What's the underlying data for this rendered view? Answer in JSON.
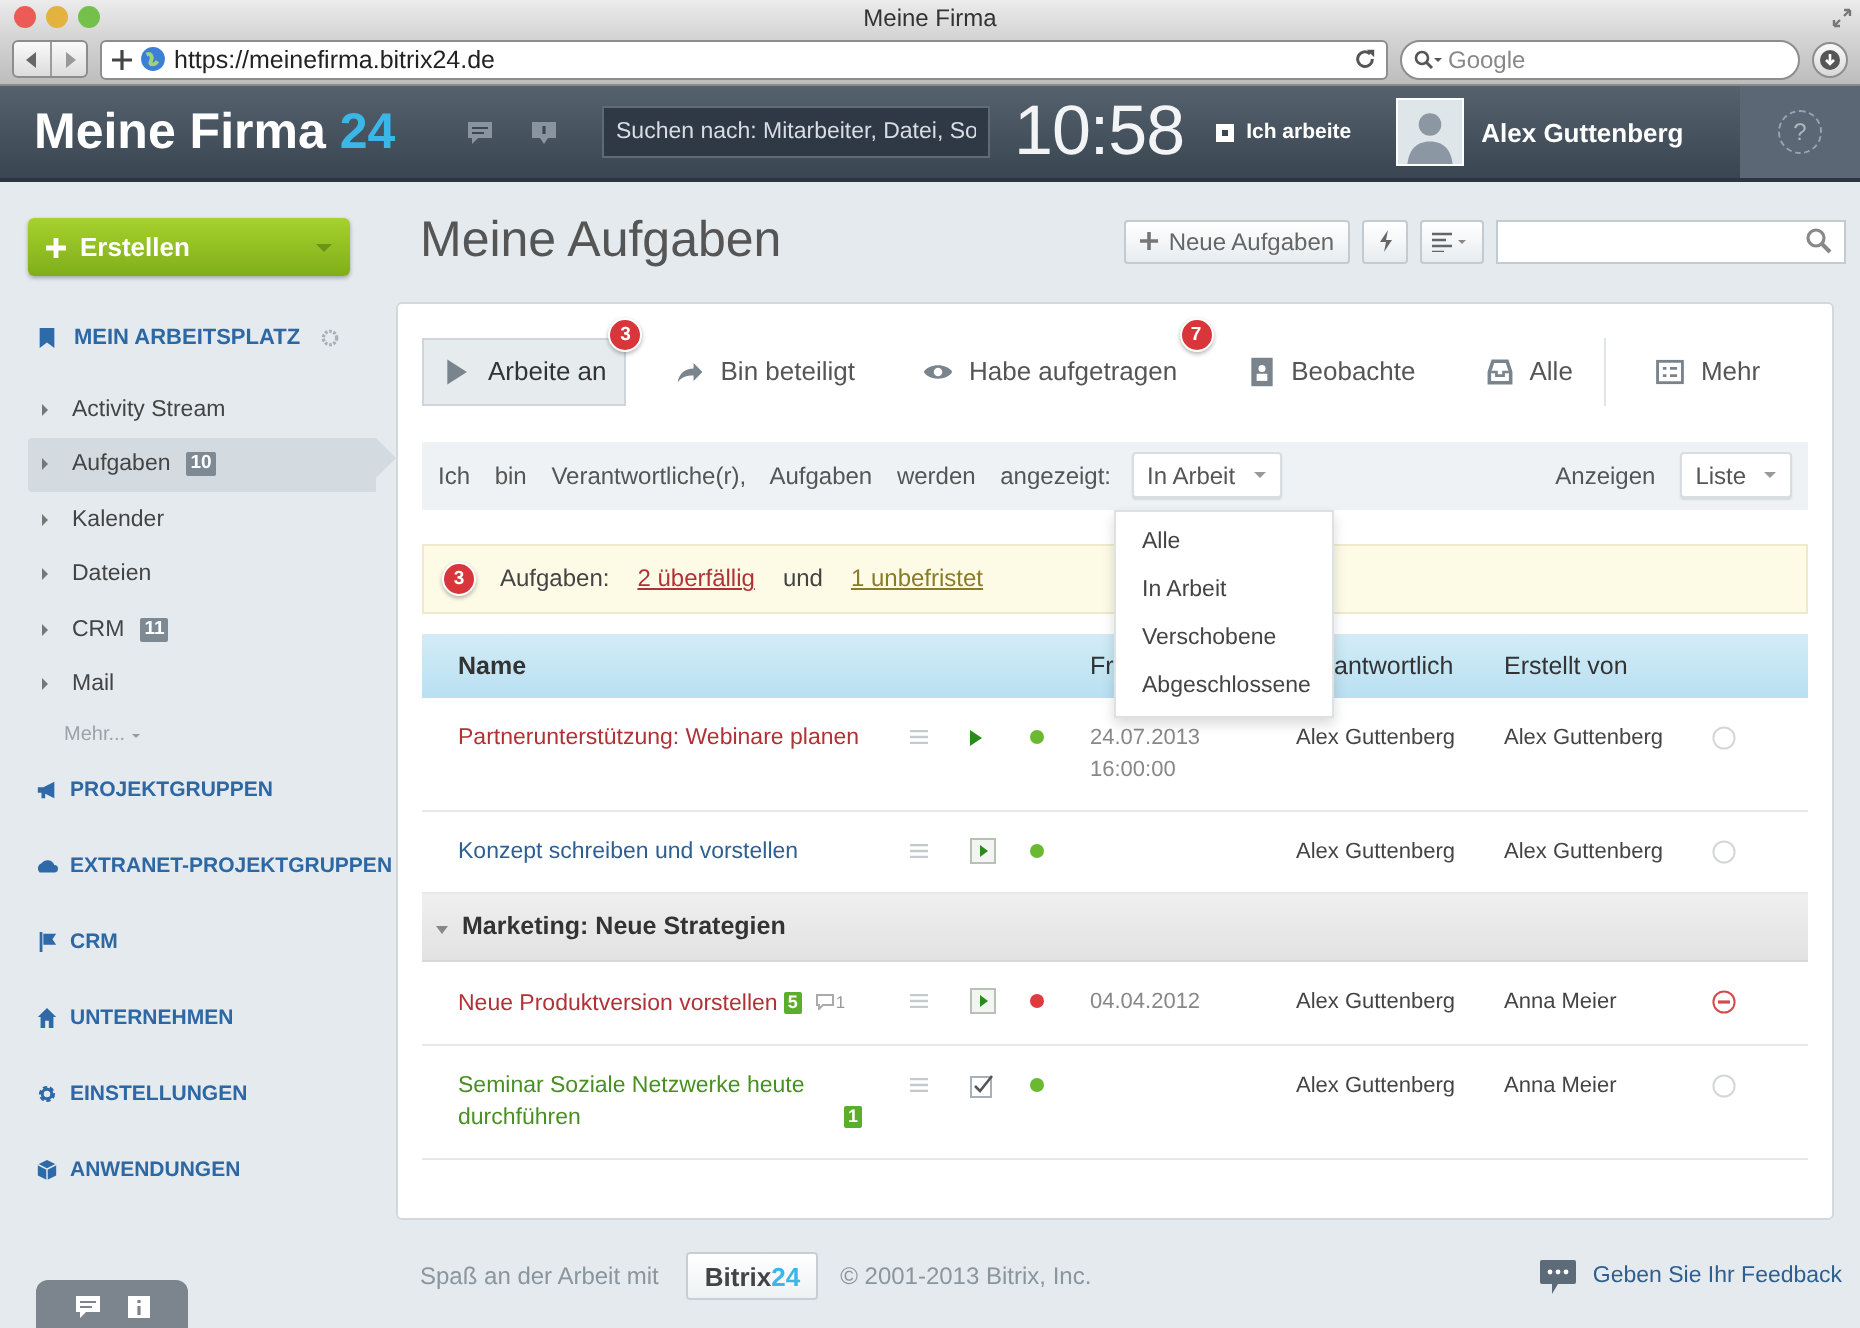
{
  "window": {
    "title": "Meine Firma"
  },
  "browser": {
    "url": "https://meinefirma.bitrix24.de",
    "search_placeholder": "Google"
  },
  "header": {
    "logo": "Meine Firma",
    "logo_number": "24",
    "search_placeholder": "Suchen nach: Mitarbeiter, Datei, So",
    "clock": "10:58",
    "work_label": "Ich arbeite",
    "working": true,
    "user": "Alex Guttenberg",
    "help": "?"
  },
  "create_button": "Erstellen",
  "sidebar": {
    "workspace": "MEIN ARBEITSPLATZ",
    "items": [
      {
        "label": "Activity Stream",
        "selected": false
      },
      {
        "label": "Aufgaben",
        "counter": "10",
        "selected": true
      },
      {
        "label": "Kalender",
        "selected": false
      },
      {
        "label": "Dateien",
        "selected": false
      },
      {
        "label": "CRM",
        "counter": "11",
        "selected": false
      },
      {
        "label": "Mail",
        "selected": false
      }
    ],
    "more": "Mehr...",
    "sections": [
      "PROJEKTGRUPPEN",
      "EXTRANET-PROJEKTGRUPPEN",
      "CRM",
      "UNTERNEHMEN",
      "EINSTELLUNGEN",
      "ANWENDUNGEN"
    ]
  },
  "page_title": "Meine Aufgaben",
  "new_task_button": "Neue Aufgaben",
  "tabs": [
    {
      "label": "Arbeite an",
      "badge": "3",
      "selected": true
    },
    {
      "label": "Bin beteiligt",
      "selected": false
    },
    {
      "label": "Habe aufgetragen",
      "badge": "7",
      "selected": false
    },
    {
      "label": "Beobachte",
      "selected": false
    },
    {
      "label": "Alle",
      "selected": false
    },
    {
      "label": "Mehr",
      "selected": false
    }
  ],
  "filter": {
    "text": "Ich bin Verantwortliche(r), Aufgaben werden angezeigt:",
    "value": "In Arbeit",
    "view_label": "Anzeigen",
    "view_value": "Liste",
    "options": [
      {
        "label": "Alle"
      },
      {
        "label": "In Arbeit"
      },
      {
        "label": "Verschobene"
      },
      {
        "label": "Abgeschlossene"
      }
    ]
  },
  "alert": {
    "badge": "3",
    "label": "Aufgaben:",
    "overdue_link": "2 überfällig",
    "joiner": "und",
    "open_link": "1 unbefristet"
  },
  "table": {
    "columns": [
      "Name",
      "Fr",
      "antwortlich",
      "Erstellt von"
    ],
    "rows": [
      {
        "kind": "task",
        "title": "Partnerunterstützung: Webinare planen",
        "overdue": true,
        "completed": false,
        "started": true,
        "color": "#6ab931",
        "date": "24.07.2013",
        "time": "16:00:00",
        "responsible": "Alex Guttenberg",
        "creator": "Alex Guttenberg",
        "blocked": false
      },
      {
        "kind": "task",
        "title": "Konzept schreiben und vorstellen",
        "overdue": false,
        "completed": false,
        "started": false,
        "color": "#6ab931",
        "responsible": "Alex Guttenberg",
        "creator": "Alex Guttenberg",
        "blocked": false
      },
      {
        "kind": "group",
        "title": "Marketing: Neue Strategien",
        "expanded": true
      },
      {
        "kind": "task",
        "title": "Neue Produktversion vorstellen",
        "overdue": true,
        "completed": false,
        "started": false,
        "badge": "5",
        "comments": "1",
        "color": "#e0393e",
        "date": "04.04.2012",
        "responsible": "Alex Guttenberg",
        "creator": "Anna Meier",
        "blocked": true
      },
      {
        "kind": "task",
        "title": "Seminar Soziale Netzwerke heute durchführen",
        "overdue": false,
        "completed": true,
        "badge": "1",
        "color": "#6ab931",
        "responsible": "Alex Guttenberg",
        "creator": "Anna Meier",
        "blocked": false
      }
    ]
  },
  "footer": {
    "slogan": "Spaß an der Arbeit mit",
    "brand": "Bitrix",
    "brand_number": "24",
    "copyright": "© 2001-2013 Bitrix, Inc.",
    "feedback": "Geben Sie Ihr Feedback"
  }
}
